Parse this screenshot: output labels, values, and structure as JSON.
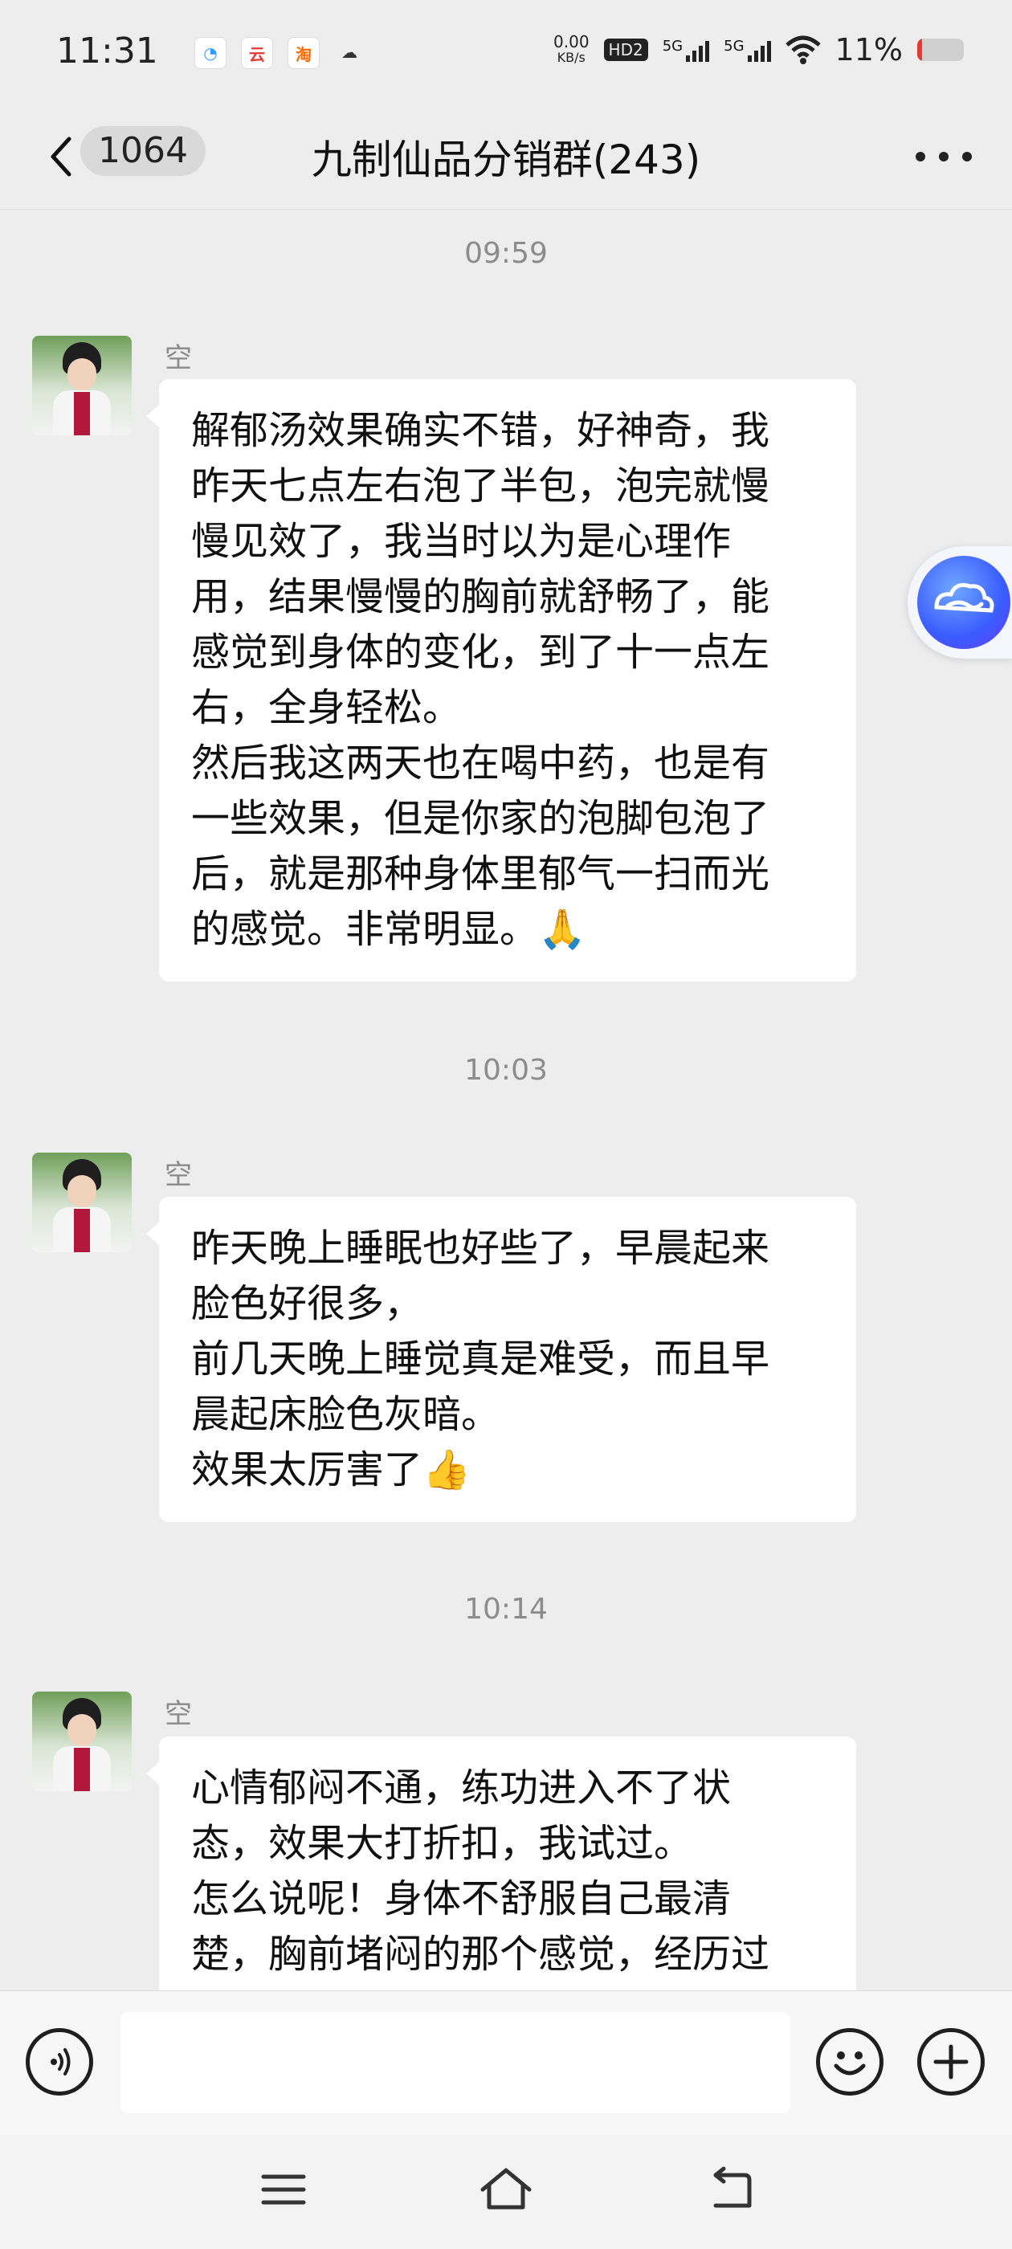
{
  "status_bar": {
    "time": "11:31",
    "app_icons": [
      {
        "name": "chat-bubble-app-icon",
        "color": "#2f9bff",
        "glyph": "◔"
      },
      {
        "name": "cloud-app-icon",
        "color": "#e53935",
        "glyph": "云"
      },
      {
        "name": "taobao-app-icon",
        "color": "#ff6a00",
        "glyph": "淘"
      },
      {
        "name": "cloud-icon",
        "color": "#333333",
        "glyph": "☁"
      }
    ],
    "net_speed_value": "0.00",
    "net_speed_unit": "KB/s",
    "hd_badge": "HD2",
    "signal_1_label": "5G",
    "signal_2_label": "5G",
    "battery_percent": "11%",
    "battery_level": 0.11
  },
  "header": {
    "back_count": "1064",
    "title": "九制仙品分销群(243)"
  },
  "messages": [
    {
      "time": "09:59",
      "sender": "空",
      "lines": [
        "解郁汤效果确实不错，好神奇，我",
        "昨天七点左右泡了半包，泡完就慢",
        "慢见效了，我当时以为是心理作",
        "用，结果慢慢的胸前就舒畅了，能",
        "感觉到身体的变化，到了十一点左",
        "右，全身轻松。",
        "然后我这两天也在喝中药，也是有",
        "一些效果，但是你家的泡脚包泡了",
        "后，就是那种身体里郁气一扫而光",
        "的感觉。非常明显。🙏"
      ]
    },
    {
      "time": "10:03",
      "sender": "空",
      "lines": [
        "昨天晚上睡眠也好些了，早晨起来",
        "脸色好很多，",
        "前几天晚上睡觉真是难受，而且早",
        "晨起床脸色灰暗。",
        "效果太厉害了👍"
      ]
    },
    {
      "time": "10:14",
      "sender": "空",
      "lines": [
        "心情郁闷不通，练功进入不了状",
        "态，效果大打折扣，我试过。",
        "怎么说呢！身体不舒服自己最清",
        "楚，胸前堵闷的那个感觉，经历过"
      ]
    }
  ],
  "input": {
    "placeholder": ""
  }
}
